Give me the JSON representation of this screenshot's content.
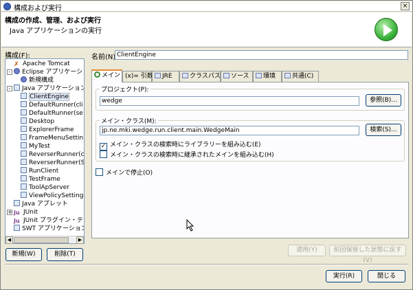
{
  "window": {
    "title": "構成および実行",
    "close_label": "×"
  },
  "banner": {
    "heading": "構成の作成、管理、および実行",
    "subtitle": "Java アプリケーションの実行"
  },
  "left": {
    "config_label": "構成(F):",
    "tree": [
      {
        "label": "Apache Tomcat",
        "icon": "tomcat-icon",
        "level": 1,
        "expander": ""
      },
      {
        "label": "Eclipse アプリケーション",
        "icon": "eclipse-icon",
        "level": 0,
        "expander": "-"
      },
      {
        "label": "新規構成",
        "icon": "eclipse-config-icon",
        "level": 2,
        "expander": ""
      },
      {
        "label": "Java アプリケーション",
        "icon": "java-app-icon",
        "level": 0,
        "expander": "-"
      },
      {
        "label": "ClientEngine",
        "icon": "java-config-icon",
        "level": 2,
        "expander": "",
        "selected": true
      },
      {
        "label": "DefaultRunner(cli",
        "icon": "java-config-icon",
        "level": 2,
        "expander": ""
      },
      {
        "label": "DefaultRunner(se",
        "icon": "java-config-icon",
        "level": 2,
        "expander": ""
      },
      {
        "label": "Desktop",
        "icon": "java-config-icon",
        "level": 2,
        "expander": ""
      },
      {
        "label": "ExplorerFrame",
        "icon": "java-config-icon",
        "level": 2,
        "expander": ""
      },
      {
        "label": "FrameMenuSettin",
        "icon": "java-config-icon",
        "level": 2,
        "expander": ""
      },
      {
        "label": "MyTest",
        "icon": "java-config-icon",
        "level": 2,
        "expander": ""
      },
      {
        "label": "ReverserRunner(c",
        "icon": "java-config-icon",
        "level": 2,
        "expander": ""
      },
      {
        "label": "ReverserRunner(S",
        "icon": "java-config-icon",
        "level": 2,
        "expander": ""
      },
      {
        "label": "RunClient",
        "icon": "java-config-icon",
        "level": 2,
        "expander": ""
      },
      {
        "label": "TestFrame",
        "icon": "java-config-icon",
        "level": 2,
        "expander": ""
      },
      {
        "label": "ToolApServer",
        "icon": "java-config-icon",
        "level": 2,
        "expander": ""
      },
      {
        "label": "ViewPolicySetting",
        "icon": "java-config-icon",
        "level": 2,
        "expander": ""
      },
      {
        "label": "Java アプレット",
        "icon": "java-applet-icon",
        "level": 1,
        "expander": ""
      },
      {
        "label": "JUnit",
        "icon": "junit-icon",
        "level": 0,
        "expander": "+"
      },
      {
        "label": "JUnit プラグイン・テスト",
        "icon": "junit-plugin-icon",
        "level": 1,
        "expander": ""
      },
      {
        "label": "SWT アプリケーション",
        "icon": "swt-icon",
        "level": 1,
        "expander": ""
      }
    ],
    "new_button": "新規(W)",
    "delete_button": "削除(T)"
  },
  "form": {
    "name_label": "名前(N):",
    "name_value": "ClientEngine",
    "tabs": [
      {
        "label": "メイン",
        "icon": "main-tab-icon",
        "active": true
      },
      {
        "label": "(x)= 引数",
        "icon": "args-tab-icon",
        "active": false
      },
      {
        "label": "JRE",
        "icon": "jre-tab-icon",
        "active": false
      },
      {
        "label": "クラスパス",
        "icon": "classpath-tab-icon",
        "active": false
      },
      {
        "label": "ソース",
        "icon": "source-tab-icon",
        "active": false
      },
      {
        "label": "環境",
        "icon": "environment-tab-icon",
        "active": false
      },
      {
        "label": "共通(C)",
        "icon": "common-tab-icon",
        "active": false
      }
    ],
    "project_group": "プロジェクト(P):",
    "project_value": "wedge",
    "browse_button": "参照(B)...",
    "main_class_group": "メイン・クラス(M):",
    "main_class_value": "jp.ne.mki.wedge.run.client.main.WedgeMain",
    "search_button": "検索(S)...",
    "chk_include_libs": "メイン・クラスの検索時にライブラリーを組み込む(E)",
    "chk_include_libs_checked": true,
    "chk_include_inherited": "メイン・クラスの検索時に継承されたメインを組み込む(H)",
    "chk_include_inherited_checked": false,
    "chk_stop_main": "メインで停止(O)",
    "chk_stop_main_checked": false,
    "apply_button": "適用(Y)",
    "revert_button": "前回保管した状態に戻す(V)"
  },
  "footer": {
    "run_button": "実行(R)",
    "close_button": "閉じる"
  },
  "checkmark": "✓"
}
